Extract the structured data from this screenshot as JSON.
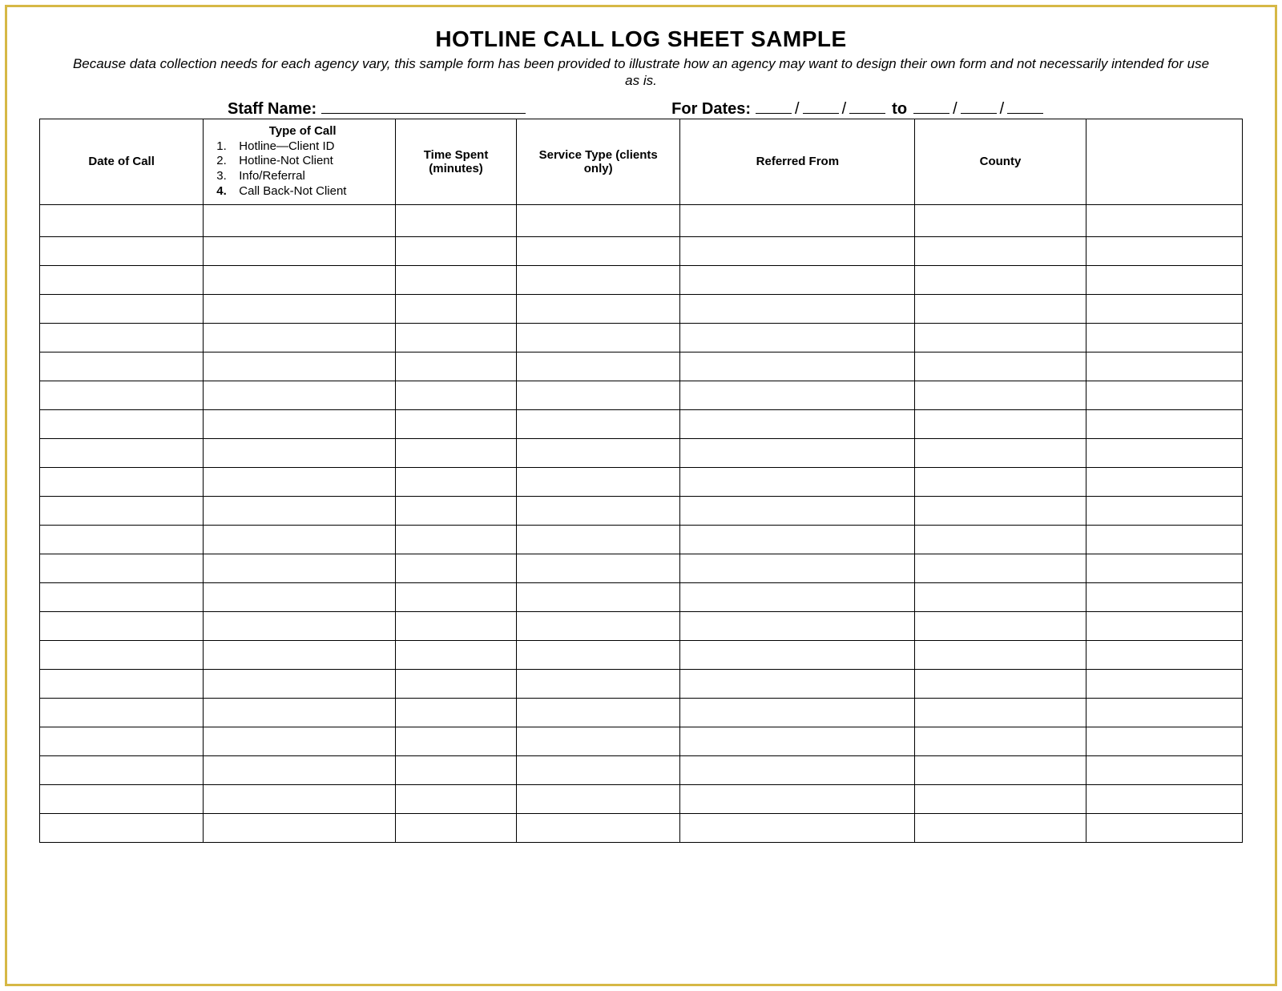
{
  "title": "HOTLINE CALL LOG SHEET SAMPLE",
  "subtitle": "Because data collection needs for each agency vary, this sample form has been provided to illustrate how an agency may want to design their own form and not necessarily intended for use as is.",
  "meta": {
    "staff_label": "Staff Name:",
    "for_dates_label": "For Dates:",
    "to_word": "to"
  },
  "columns": {
    "date": "Date of Call",
    "type_title": "Type of Call",
    "type_options": [
      {
        "num": "1.",
        "text": "Hotline—Client ID"
      },
      {
        "num": "2.",
        "text": "Hotline-Not Client"
      },
      {
        "num": "3.",
        "text": "Info/Referral"
      },
      {
        "num": "4.",
        "text": "Call Back-Not Client"
      }
    ],
    "time": "Time Spent (minutes)",
    "service": "Service Type (clients only)",
    "referred": "Referred From",
    "county": "County",
    "blank": ""
  },
  "row_count": 22
}
